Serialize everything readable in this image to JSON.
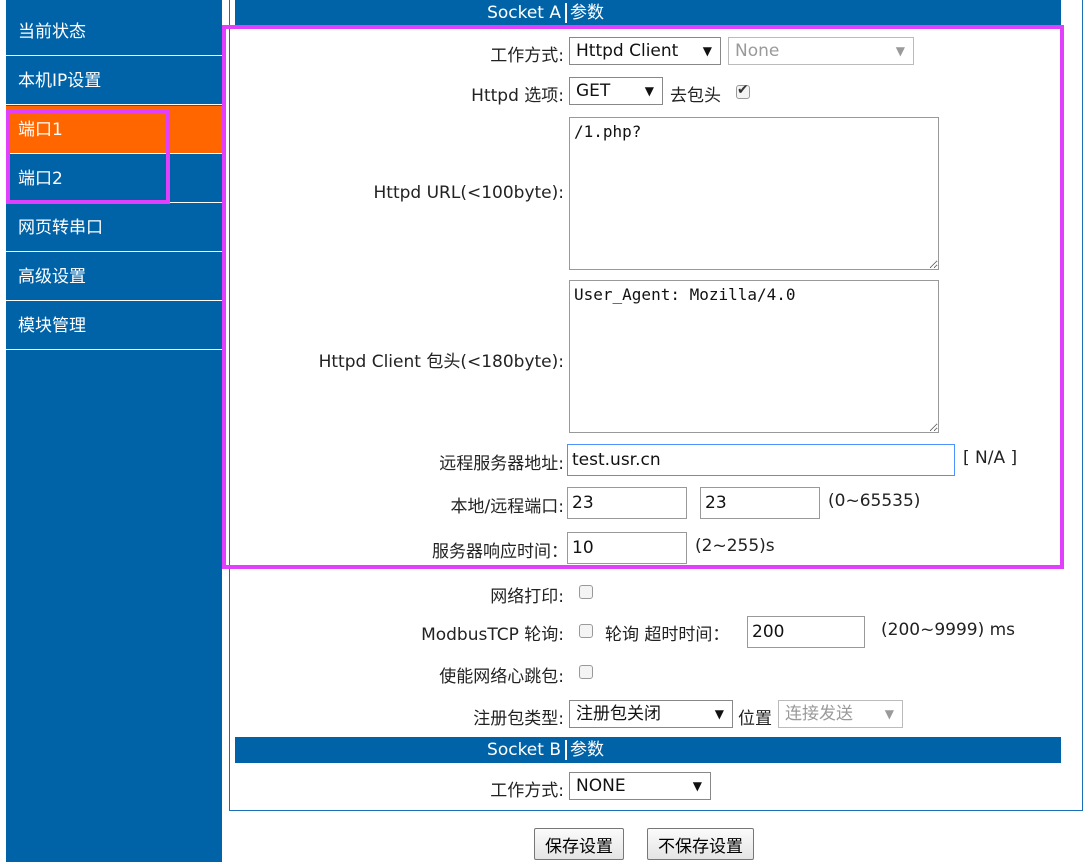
{
  "sidebar": {
    "items": [
      {
        "label": "当前状态"
      },
      {
        "label": "本机IP设置"
      },
      {
        "label": "端口1"
      },
      {
        "label": "端口2"
      },
      {
        "label": "网页转串口"
      },
      {
        "label": "高级设置"
      },
      {
        "label": "模块管理"
      }
    ],
    "active_index": 2
  },
  "socket_a": {
    "title_left": "Socket A",
    "title_right": "参数",
    "work_mode_label": "工作方式:",
    "work_mode_value": "Httpd Client",
    "work_mode_sub_value": "None",
    "httpd_option_label": "Httpd 选项:",
    "httpd_method": "GET",
    "strip_header_label": "去包头",
    "strip_header_checked": true,
    "url_label": "Httpd URL(<100byte):",
    "url_value": "/1.php?",
    "header_label": "Httpd Client 包头(<180byte):",
    "header_value": "User_Agent: Mozilla/4.0",
    "server_label": "远程服务器地址:",
    "server_value": "test.usr.cn",
    "server_status": "[ N/A ]",
    "ports_label": "本地/远程端口:",
    "local_port": "23",
    "remote_port": "23",
    "ports_range": "(0~65535)",
    "timeout_label": "服务器响应时间：",
    "timeout_value": "10",
    "timeout_range": "(2~255)s",
    "net_print_label": "网络打印:",
    "modbus_label": "ModbusTCP 轮询:",
    "modbus_poll_text": "轮询 超时时间：",
    "modbus_timeout": "200",
    "modbus_range": "(200~9999) ms",
    "heartbeat_label": "使能网络心跳包:",
    "reg_type_label": "注册包类型:",
    "reg_type_value": "注册包关闭",
    "position_label": "位置",
    "position_value": "连接发送"
  },
  "socket_b": {
    "title_left": "Socket B",
    "title_right": "参数",
    "work_mode_label": "工作方式:",
    "work_mode_value": "NONE"
  },
  "buttons": {
    "save": "保存设置",
    "nosave": "不保存设置"
  },
  "colors": {
    "sidebar_bg": "#0063a8",
    "active_bg": "#ff6600",
    "highlight": "#e040fb"
  }
}
